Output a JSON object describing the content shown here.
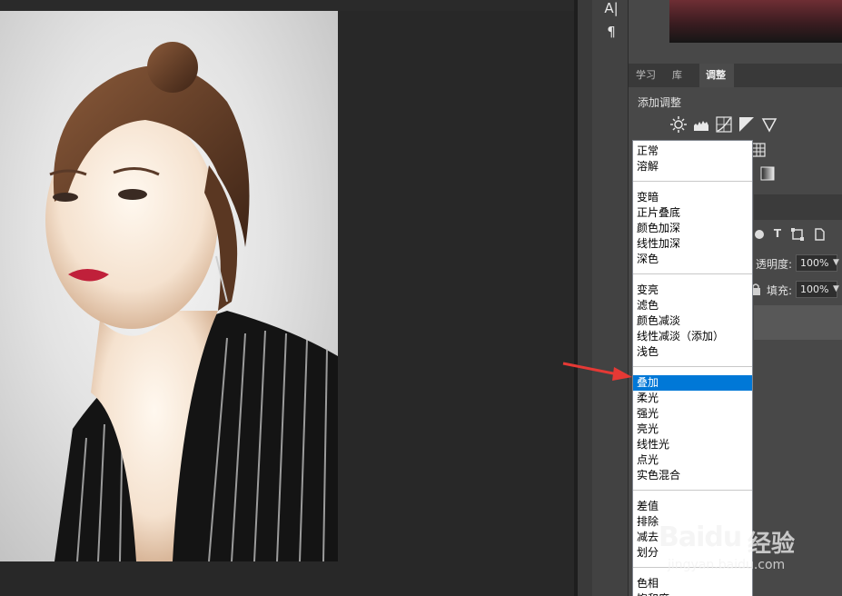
{
  "tool_column": {
    "glyphs": [
      "A|",
      "¶"
    ]
  },
  "panel_tabs": [
    {
      "label": "学习",
      "active": false
    },
    {
      "label": "库",
      "active": false
    },
    {
      "label": "调整",
      "active": true
    }
  ],
  "adjustments": {
    "title": "添加调整",
    "icons": [
      "brightness-contrast-icon",
      "levels-icon",
      "curves-icon",
      "exposure-icon",
      "vibrance-icon",
      "color-lookup-icon",
      "gradient-map-icon"
    ]
  },
  "layers_toolbar": {
    "icons": [
      "pixel-filter-icon",
      "type-filter-icon",
      "shape-filter-icon",
      "smart-object-filter-icon"
    ],
    "type_glyph": "T"
  },
  "layer_options": {
    "opacity_label": "透明度:",
    "opacity_value": "100%",
    "fill_label": "填充:",
    "fill_value": "100%"
  },
  "blend_mode_dropdown": {
    "selected": "叠加",
    "groups": [
      [
        "正常",
        "溶解"
      ],
      [
        "变暗",
        "正片叠底",
        "颜色加深",
        "线性加深",
        "深色"
      ],
      [
        "变亮",
        "滤色",
        "颜色减淡",
        "线性减淡（添加）",
        "浅色"
      ],
      [
        "叠加",
        "柔光",
        "强光",
        "亮光",
        "线性光",
        "点光",
        "实色混合"
      ],
      [
        "差值",
        "排除",
        "减去",
        "划分"
      ],
      [
        "色相",
        "饱和度"
      ]
    ]
  },
  "annotation": {
    "arrow_color": "#e53935"
  },
  "watermark": {
    "brand": "Baidu",
    "brand_cn": "经验",
    "url": "jingyan.baidu.com"
  },
  "colors": {
    "selection": "#0078d7",
    "panel_bg": "#484848",
    "canvas_bg": "#282828"
  }
}
